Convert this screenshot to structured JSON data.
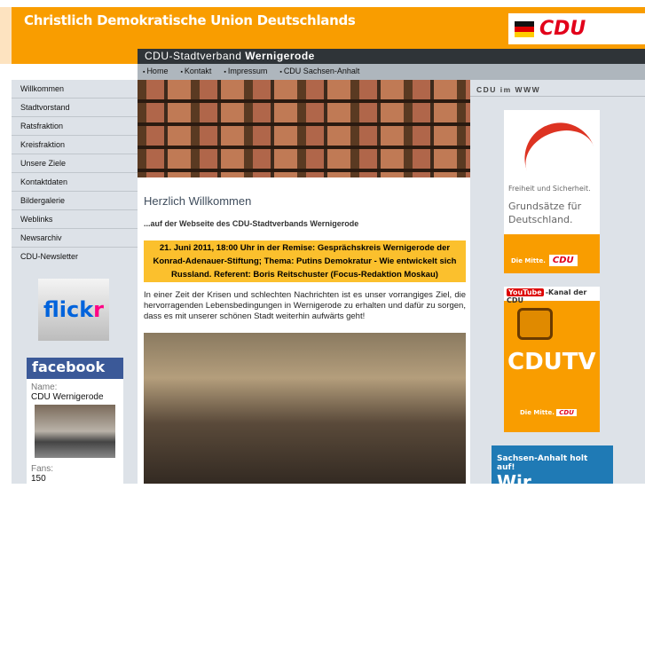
{
  "header": {
    "org": "Christlich Demokratische Union Deutschlands",
    "logo": "CDU",
    "site_prefix": "CDU-Stadtverband ",
    "site_name": "Wernigerode"
  },
  "nav": [
    "Home",
    "Kontakt",
    "Impressum",
    "CDU Sachsen-Anhalt"
  ],
  "menu": [
    "Willkommen",
    "Stadtvorstand",
    "Ratsfraktion",
    "Kreisfraktion",
    "Unsere Ziele",
    "Kontaktdaten",
    "Bildergalerie",
    "Weblinks",
    "Newsarchiv",
    "CDU-Newsletter"
  ],
  "flickr": {
    "a": "flick",
    "b": "r"
  },
  "facebook": {
    "title": "facebook",
    "name_label": "Name:",
    "name": "CDU Wernigerode",
    "fans_label": "Fans:",
    "fans": "150"
  },
  "main": {
    "title": "Herzlich Willkommen",
    "subtitle": "...auf der Webseite des CDU-Stadtverbands Wernigerode",
    "event": "21. Juni 2011, 18:00 Uhr in der Remise: Gesprächskreis Wernigerode der Konrad-Adenauer-Stiftung; Thema: Putins Demokratur - Wie entwickelt sich Russland. Referent: Boris Reitschuster (Focus-Redaktion Moskau)",
    "text": "In einer Zeit der Krisen und schlechten Nachrichten ist es unser vorrangiges Ziel, die hervorragenden Lebensbedingungen in Wernigerode zu erhalten und dafür zu sorgen, dass es mit unserer schönen Stadt weiterhin aufwärts geht!"
  },
  "right": {
    "title": "CDU im WWW",
    "ad1": {
      "line1": "Freiheit und Sicherheit.",
      "line2": "Grundsätze für Deutschland.",
      "tag": "Die Mitte.",
      "logo": "CDU"
    },
    "ad2": {
      "yt": "YouTube",
      "kanal": "-Kanal der CDU",
      "big": "CDUTV",
      "tag": "Die Mitte.",
      "logo": "CDU"
    },
    "ad3": {
      "line1": "Sachsen-Anhalt holt auf!",
      "line2": "Wir"
    }
  }
}
